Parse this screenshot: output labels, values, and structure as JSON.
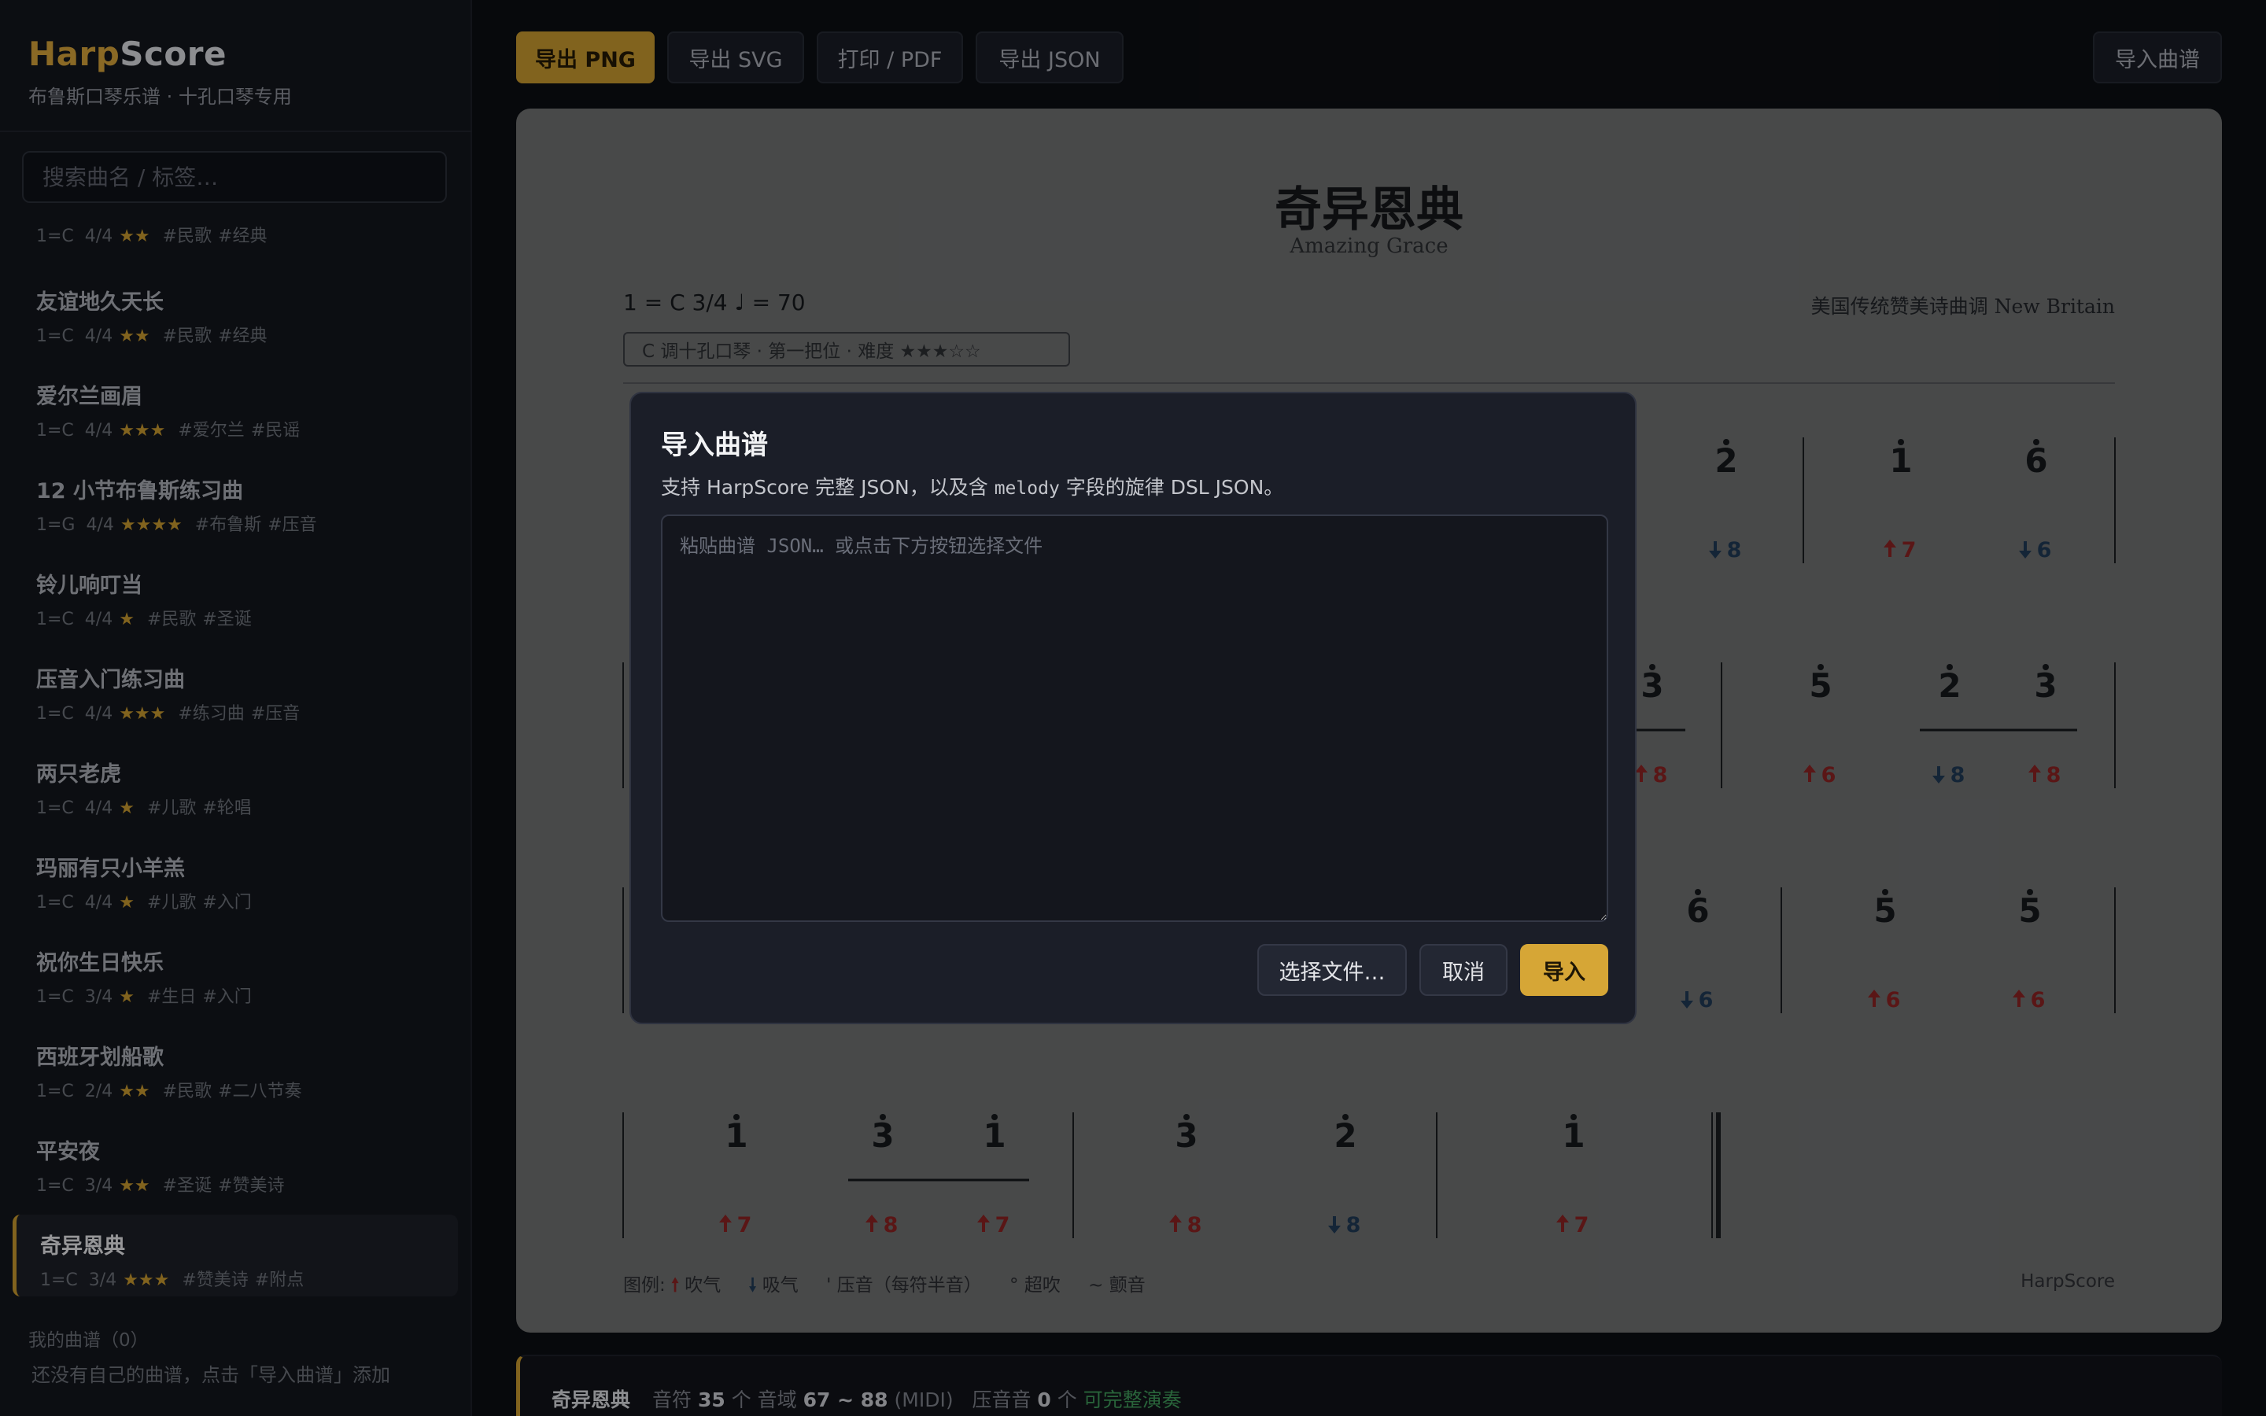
{
  "brand": {
    "name_part1": "Harp",
    "name_part2": "Score",
    "subtitle": "布鲁斯口琴乐谱 · 十孔口琴专用"
  },
  "search": {
    "placeholder": "搜索曲名 / 标签…"
  },
  "first_item_meta": {
    "key": "1=C",
    "time": "4/4",
    "stars": "★★",
    "tags": [
      "#民歌",
      "#经典"
    ]
  },
  "songs": [
    {
      "title": "友谊地久天长",
      "key": "1=C",
      "time": "4/4",
      "stars": "★★",
      "tags": [
        "#民歌",
        "#经典"
      ]
    },
    {
      "title": "爱尔兰画眉",
      "key": "1=C",
      "time": "4/4",
      "stars": "★★★",
      "tags": [
        "#爱尔兰",
        "#民谣"
      ]
    },
    {
      "title": "12 小节布鲁斯练习曲",
      "key": "1=G",
      "time": "4/4",
      "stars": "★★★★",
      "tags": [
        "#布鲁斯",
        "#压音"
      ]
    },
    {
      "title": "铃儿响叮当",
      "key": "1=C",
      "time": "4/4",
      "stars": "★",
      "tags": [
        "#民歌",
        "#圣诞"
      ]
    },
    {
      "title": "压音入门练习曲",
      "key": "1=C",
      "time": "4/4",
      "stars": "★★★",
      "tags": [
        "#练习曲",
        "#压音"
      ]
    },
    {
      "title": "两只老虎",
      "key": "1=C",
      "time": "4/4",
      "stars": "★",
      "tags": [
        "#儿歌",
        "#轮唱"
      ]
    },
    {
      "title": "玛丽有只小羊羔",
      "key": "1=C",
      "time": "4/4",
      "stars": "★",
      "tags": [
        "#儿歌",
        "#入门"
      ]
    },
    {
      "title": "祝你生日快乐",
      "key": "1=C",
      "time": "3/4",
      "stars": "★",
      "tags": [
        "#生日",
        "#入门"
      ]
    },
    {
      "title": "西班牙划船歌",
      "key": "1=C",
      "time": "2/4",
      "stars": "★★",
      "tags": [
        "#民歌",
        "#二八节奏"
      ]
    },
    {
      "title": "平安夜",
      "key": "1=C",
      "time": "3/4",
      "stars": "★★",
      "tags": [
        "#圣诞",
        "#赞美诗"
      ]
    },
    {
      "title": "奇异恩典",
      "key": "1=C",
      "time": "3/4",
      "stars": "★★★",
      "tags": [
        "#赞美诗",
        "#附点"
      ]
    }
  ],
  "my_songs": {
    "heading": "我的曲谱（0）",
    "empty": "还没有自己的曲谱，点击「导入曲谱」添加"
  },
  "toolbar": {
    "export_png": "导出 PNG",
    "export_svg": "导出 SVG",
    "print_pdf": "打印 / PDF",
    "export_json": "导出 JSON",
    "import": "导入曲谱"
  },
  "score": {
    "title": "奇异恩典",
    "subtitle": "Amazing Grace",
    "key_line": "1 = C 3/4 ♩ = 70",
    "origin": "美国传统赞美诗曲调 New Britain",
    "badge": "C 调十孔口琴 · 第一把位 · 难度 ★★★☆☆",
    "visible_notes": {
      "row1": [
        {
          "digit": "2",
          "dir": "down",
          "hole": "8"
        },
        {
          "digit": "1",
          "dir": "up",
          "hole": "7"
        },
        {
          "digit": "6",
          "dir": "down",
          "hole": "6"
        }
      ],
      "row2": [
        {
          "digit": "3",
          "dir": "up",
          "hole": "8"
        },
        {
          "digit": "5",
          "dir": "up",
          "hole": "6"
        },
        {
          "digit": "2",
          "dir": "down",
          "hole": "8"
        },
        {
          "digit": "3",
          "dir": "up",
          "hole": "8"
        }
      ],
      "row3": [
        {
          "digit": "6",
          "dir": "down",
          "hole": "6"
        },
        {
          "digit": "5",
          "dir": "up",
          "hole": "6"
        },
        {
          "digit": "5",
          "dir": "up",
          "hole": "6"
        }
      ],
      "row4": [
        {
          "digit": "1",
          "dir": "up",
          "hole": "7"
        },
        {
          "digit": "3",
          "dir": "up",
          "hole": "8"
        },
        {
          "digit": "1",
          "dir": "up",
          "hole": "7"
        },
        {
          "digit": "3",
          "dir": "up",
          "hole": "8"
        },
        {
          "digit": "2",
          "dir": "down",
          "hole": "8"
        },
        {
          "digit": "1",
          "dir": "up",
          "hole": "7"
        }
      ]
    },
    "legend": {
      "label": "图例:",
      "blow": "吹气",
      "draw": "吸气",
      "bend_mark": "'",
      "bend": "压音（每符半音）",
      "over_mark": "°",
      "over": "超吹",
      "trill_mark": "~",
      "trill": "颤音"
    },
    "brand": "HarpScore"
  },
  "status": {
    "name": "奇异恩典",
    "notes_label": "音符",
    "notes_count": "35",
    "notes_unit": "个",
    "range_label": "音域",
    "range": "67 ~ 88",
    "range_unit": "(MIDI)",
    "bend_label": "压音音",
    "bend_count": "0",
    "bend_unit": "个",
    "playable": "可完整演奏"
  },
  "modal": {
    "title": "导入曲谱",
    "desc_pre": "支持 HarpScore 完整 JSON，以及含 ",
    "desc_code": "melody",
    "desc_post": " 字段的旋律 DSL JSON。",
    "placeholder": "粘贴曲谱 JSON… 或点击下方按钮选择文件",
    "choose_file": "选择文件…",
    "cancel": "取消",
    "import": "导入"
  },
  "colors": {
    "accent": "#c7982e",
    "blow": "#8a2222",
    "draw": "#1f3a55",
    "ok": "#3f9a5a"
  }
}
